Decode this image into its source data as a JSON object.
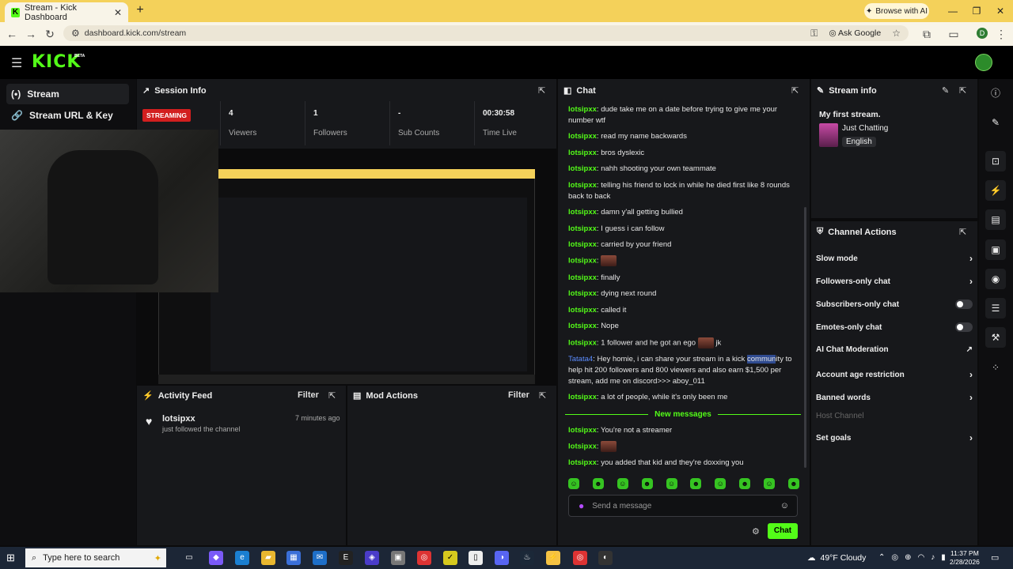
{
  "browser": {
    "tab_title": "Stream - Kick Dashboard",
    "url": "dashboard.kick.com/stream",
    "ask_google": "Ask Google",
    "browse_ai": "Browse with AI",
    "profile_initial": "D"
  },
  "header": {
    "logo": "KICK",
    "beta": "BETA"
  },
  "leftnav": [
    {
      "label": "Stream",
      "icon": "broadcast-icon"
    },
    {
      "label": "Stream URL & Key",
      "icon": "link-icon"
    }
  ],
  "session": {
    "title": "Session Info",
    "badge": "STREAMING",
    "stats": [
      {
        "value": "4",
        "label": "Viewers"
      },
      {
        "value": "1",
        "label": "Followers"
      },
      {
        "value": "-",
        "label": "Sub Counts"
      },
      {
        "value": "00:30:58",
        "label": "Time Live"
      }
    ]
  },
  "activity": {
    "title": "Activity Feed",
    "filter": "Filter",
    "item": {
      "user": "lotsipxx",
      "text": "just followed the channel",
      "time": "7 minutes ago"
    }
  },
  "mod": {
    "title": "Mod Actions",
    "filter": "Filter"
  },
  "chat": {
    "title": "Chat",
    "messages": [
      {
        "user": "lotsipxx",
        "text": "dude take me on a date before trying to give me your number wtf"
      },
      {
        "user": "lotsipxx",
        "text": "read my name backwards"
      },
      {
        "user": "lotsipxx",
        "text": "bros dyslexic"
      },
      {
        "user": "lotsipxx",
        "text": "nahh shooting your own teammate"
      },
      {
        "user": "lotsipxx",
        "text": "telling his friend to lock in while he died first like 8 rounds back to back"
      },
      {
        "user": "lotsipxx",
        "text": "damn y'all getting bullied"
      },
      {
        "user": "lotsipxx",
        "text": "I guess i can follow"
      },
      {
        "user": "lotsipxx",
        "text": "carried by your friend"
      },
      {
        "user": "lotsipxx",
        "text": ""
      },
      {
        "user": "lotsipxx",
        "text": "finally"
      },
      {
        "user": "lotsipxx",
        "text": "dying next round"
      },
      {
        "user": "lotsipxx",
        "text": "called it"
      },
      {
        "user": "lotsipxx",
        "text": "Nope"
      },
      {
        "user": "lotsipxx",
        "text": "1 follower and he got an ego",
        "after": "jk"
      },
      {
        "user": "Tatata4",
        "text_a": "Hey homie, i can share your stream in a kick ",
        "hl": "commun",
        "text_b": "ity to help hit 200 followers and 800 viewers and also earn $1,500 per stream, add me on discord>>> aboy_011"
      },
      {
        "user": "lotsipxx",
        "text": "a lot of people, while it's only been me"
      }
    ],
    "new_messages": "New messages",
    "new": [
      {
        "user": "lotsipxx",
        "text": "You're not a streamer"
      },
      {
        "user": "lotsipxx",
        "text": ""
      },
      {
        "user": "lotsipxx",
        "text": "you added that kid and they're doxxing you"
      }
    ],
    "placeholder": "Send a message",
    "send": "Chat"
  },
  "streaminfo": {
    "title": "Stream info",
    "stream_title": "My first stream.",
    "category": "Just Chatting",
    "language": "English"
  },
  "channel_actions": {
    "title": "Channel Actions",
    "items": [
      {
        "label": "Slow mode",
        "control": "chevron"
      },
      {
        "label": "Followers-only chat",
        "control": "chevron"
      },
      {
        "label": "Subscribers-only chat",
        "control": "toggle"
      },
      {
        "label": "Emotes-only chat",
        "control": "toggle"
      },
      {
        "label": "AI Chat Moderation",
        "control": "external"
      },
      {
        "label": "Account age restriction",
        "control": "chevron"
      },
      {
        "label": "Banned words",
        "control": "chevron"
      },
      {
        "label": "Host Channel",
        "control": "none"
      },
      {
        "label": "Set goals",
        "control": "chevron"
      }
    ]
  },
  "taskbar": {
    "search_placeholder": "Type here to search",
    "weather": "49°F  Cloudy",
    "time": "11:37 PM",
    "date": "2/28/2026"
  }
}
